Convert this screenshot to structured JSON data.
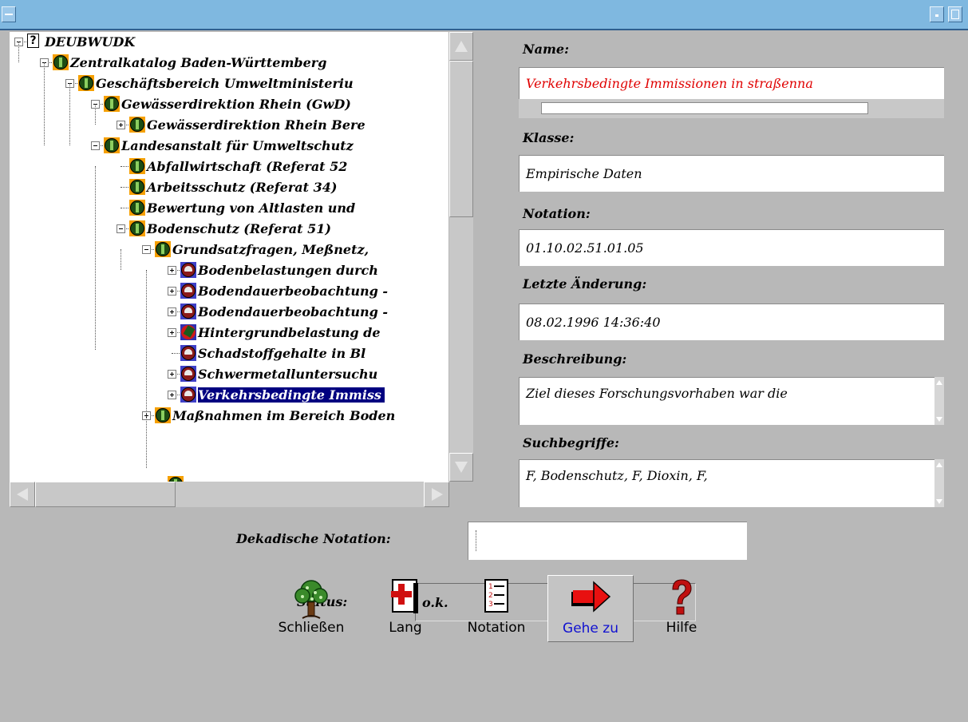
{
  "tree": {
    "items": [
      {
        "label": "DEUBWUDK",
        "icon": "question-icon",
        "toggle": "minus"
      },
      {
        "label": "Zentralkatalog Baden-Württemberg",
        "icon": "green-catalog-icon",
        "toggle": "minus"
      },
      {
        "label": "Geschäftsbereich Umweltministeriu",
        "icon": "green-catalog-icon",
        "toggle": "minus"
      },
      {
        "label": "Gewässerdirektion Rhein (GwD)",
        "icon": "green-catalog-icon",
        "toggle": "minus"
      },
      {
        "label": "Gewässerdirektion Rhein Bere",
        "icon": "green-catalog-icon",
        "toggle": "plus"
      },
      {
        "label": "Landesanstalt für Umweltschutz",
        "icon": "green-catalog-icon",
        "toggle": "minus"
      },
      {
        "label": "Abfallwirtschaft (Referat 52",
        "icon": "green-catalog-icon",
        "toggle": "none"
      },
      {
        "label": "Arbeitsschutz (Referat 34)",
        "icon": "green-catalog-icon",
        "toggle": "none"
      },
      {
        "label": "Bewertung von Altlasten und",
        "icon": "green-catalog-icon",
        "toggle": "none"
      },
      {
        "label": "Bodenschutz (Referat 51)",
        "icon": "green-catalog-icon",
        "toggle": "minus"
      },
      {
        "label": "Grundsatzfragen, Meßnetz,",
        "icon": "green-catalog-icon",
        "toggle": "minus"
      },
      {
        "label": "Bodenbelastungen durch",
        "icon": "brown-data-icon",
        "toggle": "plus"
      },
      {
        "label": "Bodendauerbeobachtung -",
        "icon": "brown-data-icon",
        "toggle": "plus"
      },
      {
        "label": "Bodendauerbeobachtung -",
        "icon": "brown-data-icon",
        "toggle": "plus"
      },
      {
        "label": "Hintergrundbelastung de",
        "icon": "bird-icon",
        "toggle": "plus"
      },
      {
        "label": "Schadstoffgehalte in Bl",
        "icon": "brown-data-icon",
        "toggle": "none"
      },
      {
        "label": "Schwermetalluntersuchu",
        "icon": "brown-data-icon",
        "toggle": "plus"
      },
      {
        "label": "Verkehrsbedingte Immiss",
        "icon": "brown-data-icon",
        "toggle": "plus",
        "selected": true
      },
      {
        "label": "Maßnahmen im Bereich Boden",
        "icon": "green-catalog-icon",
        "toggle": "plus"
      }
    ]
  },
  "form": {
    "name_label": "Name:",
    "name_value": "Verkehrsbedingte Immissionen in straßenna",
    "klasse_label": "Klasse:",
    "klasse_value": "Empirische Daten",
    "notation_label": "Notation:",
    "notation_value": "01.10.02.51.01.05",
    "aenderung_label": "Letzte Änderung:",
    "aenderung_value": "08.02.1996 14:36:40",
    "beschreibung_label": "Beschreibung:",
    "beschreibung_value": "Ziel dieses Forschungsvorhaben war die",
    "suchbegriffe_label": "Suchbegriffe:",
    "suchbegriffe_value": "F, Bodenschutz, F, Dioxin, F,",
    "dekadisch_label": "Dekadische Notation:",
    "dekadisch_value": "",
    "status_label": "Status:",
    "status_value": "o.k."
  },
  "toolbar": {
    "close_label": "Schließen",
    "lang_label": "Lang",
    "notation_label": "Notation",
    "goto_label": "Gehe zu",
    "help_label": "Hilfe"
  },
  "colors": {
    "name_value_text": "#e00000",
    "selection": "#000080",
    "title_bar": "#7fb8e0"
  }
}
